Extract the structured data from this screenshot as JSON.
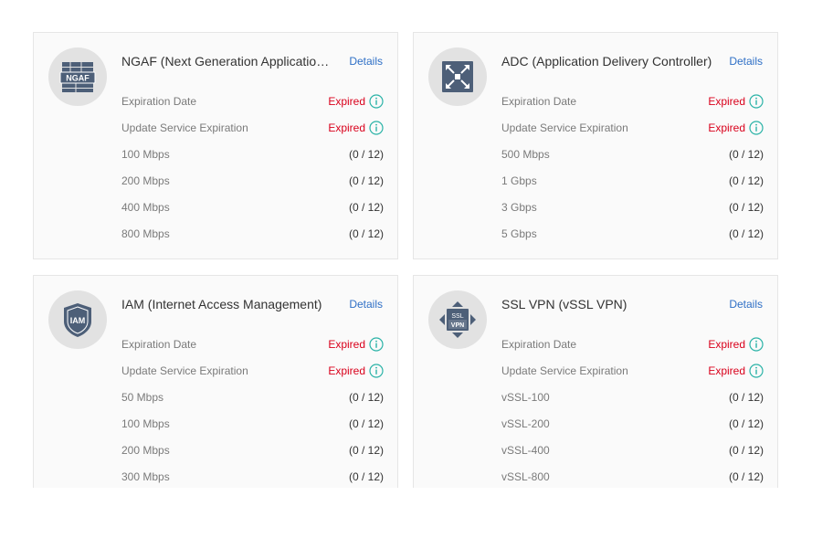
{
  "cards": [
    {
      "title": "NGAF (Next Generation Application Firewall)",
      "icon": "ngaf-firewall-icon",
      "icon_text": "NGAF",
      "details_label": "Details",
      "rows": [
        {
          "label": "Expiration Date",
          "value": "Expired",
          "expired": true
        },
        {
          "label": "Update Service Expiration",
          "value": "Expired",
          "expired": true
        },
        {
          "label": "100 Mbps",
          "value": "(0 / 12)",
          "expired": false
        },
        {
          "label": "200 Mbps",
          "value": "(0 / 12)",
          "expired": false
        },
        {
          "label": "400 Mbps",
          "value": "(0 / 12)",
          "expired": false
        },
        {
          "label": "800 Mbps",
          "value": "(0 / 12)",
          "expired": false
        }
      ]
    },
    {
      "title": "ADC (Application Delivery Controller)",
      "icon": "adc-arrows-icon",
      "details_label": "Details",
      "rows": [
        {
          "label": "Expiration Date",
          "value": "Expired",
          "expired": true
        },
        {
          "label": "Update Service Expiration",
          "value": "Expired",
          "expired": true
        },
        {
          "label": "500 Mbps",
          "value": "(0 / 12)",
          "expired": false
        },
        {
          "label": "1 Gbps",
          "value": "(0 / 12)",
          "expired": false
        },
        {
          "label": "3 Gbps",
          "value": "(0 / 12)",
          "expired": false
        },
        {
          "label": "5 Gbps",
          "value": "(0 / 12)",
          "expired": false
        }
      ]
    },
    {
      "title": "IAM (Internet Access Management)",
      "icon": "iam-shield-icon",
      "icon_text": "IAM",
      "details_label": "Details",
      "rows": [
        {
          "label": "Expiration Date",
          "value": "Expired",
          "expired": true
        },
        {
          "label": "Update Service Expiration",
          "value": "Expired",
          "expired": true
        },
        {
          "label": "50 Mbps",
          "value": "(0 / 12)",
          "expired": false
        },
        {
          "label": "100 Mbps",
          "value": "(0 / 12)",
          "expired": false
        },
        {
          "label": "200 Mbps",
          "value": "(0 / 12)",
          "expired": false
        },
        {
          "label": "300 Mbps",
          "value": "(0 / 12)",
          "expired": false
        }
      ]
    },
    {
      "title": "SSL VPN (vSSL VPN)",
      "icon": "ssl-vpn-icon",
      "icon_text_top": "SSL",
      "icon_text_bottom": "VPN",
      "details_label": "Details",
      "rows": [
        {
          "label": "Expiration Date",
          "value": "Expired",
          "expired": true
        },
        {
          "label": "Update Service Expiration",
          "value": "Expired",
          "expired": true
        },
        {
          "label": "vSSL-100",
          "value": "(0 / 12)",
          "expired": false
        },
        {
          "label": "vSSL-200",
          "value": "(0 / 12)",
          "expired": false
        },
        {
          "label": "vSSL-400",
          "value": "(0 / 12)",
          "expired": false
        },
        {
          "label": "vSSL-800",
          "value": "(0 / 12)",
          "expired": false
        }
      ]
    }
  ],
  "colors": {
    "expired": "#d9001b",
    "link": "#2e6fc6",
    "info_icon": "#2bb3a7",
    "icon_dark": "#4d5f78"
  }
}
